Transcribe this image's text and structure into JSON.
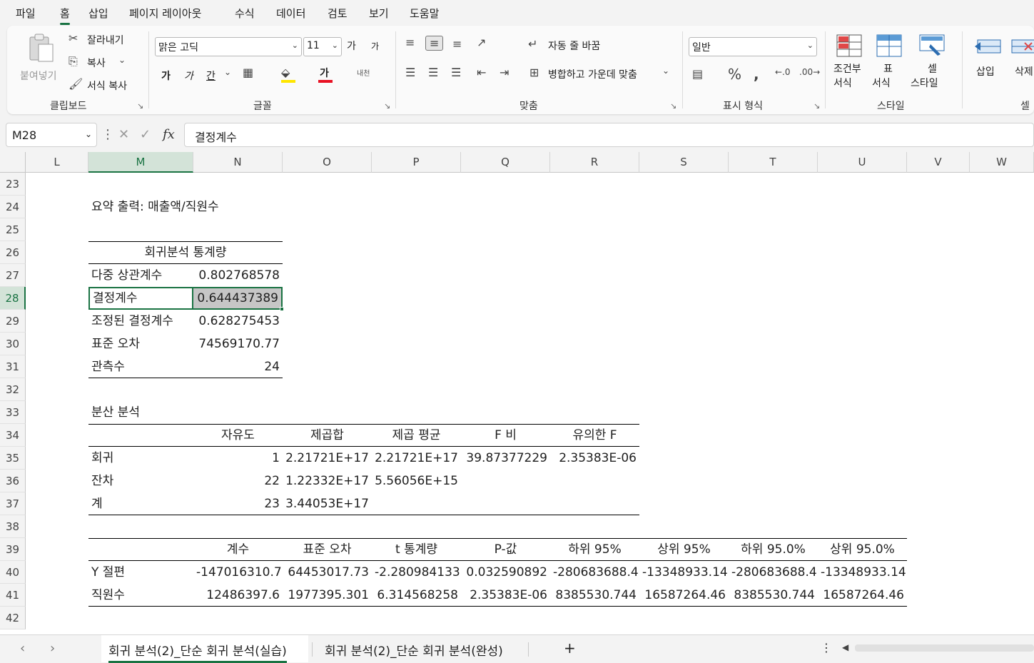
{
  "menu": [
    "파일",
    "홈",
    "삽입",
    "페이지 레이아웃",
    "수식",
    "데이터",
    "검토",
    "보기",
    "도움말"
  ],
  "ribbon": {
    "clipboard": {
      "paste": "붙여넣기",
      "cut": "잘라내기",
      "copy": "복사",
      "format_painter": "서식 복사",
      "label": "클립보드"
    },
    "font": {
      "name": "맑은 고딕",
      "size": "11",
      "grow": "가",
      "shrink": "가",
      "bold": "가",
      "italic": "가",
      "underline": "간",
      "color_letter": "가",
      "phonetic": "내천",
      "label": "글꼴"
    },
    "align": {
      "wrap": "자동 줄 바꿈",
      "merge": "병합하고 가운데 맞춤",
      "label": "맞춤"
    },
    "number": {
      "format": "일반",
      "label": "표시 형식"
    },
    "styles": {
      "conditional": [
        "조건부",
        "서식"
      ],
      "table": [
        "표",
        "서식"
      ],
      "cell": [
        "셀",
        "스타일"
      ],
      "label": "스타일"
    },
    "cells": {
      "insert": "삽입",
      "delete": "삭제",
      "label": "셀"
    }
  },
  "formula_bar": {
    "name_box": "M28",
    "content": "결정계수"
  },
  "columns": [
    "L",
    "M",
    "N",
    "O",
    "P",
    "Q",
    "R",
    "S",
    "T",
    "U",
    "V",
    "W"
  ],
  "rows": [
    "23",
    "24",
    "25",
    "26",
    "27",
    "28",
    "29",
    "30",
    "31",
    "32",
    "33",
    "34",
    "35",
    "36",
    "37",
    "38",
    "39",
    "40",
    "41",
    "42"
  ],
  "sheet": {
    "summary_title": "요약 출력: 매출액/직원수",
    "regression_stats_header": "회귀분석 통계량",
    "regression_stats": [
      {
        "label": "다중 상관계수",
        "value": "0.802768578"
      },
      {
        "label": "결정계수",
        "value": "0.644437389"
      },
      {
        "label": "조정된 결정계수",
        "value": "0.628275453"
      },
      {
        "label": "표준 오차",
        "value": "74569170.77"
      },
      {
        "label": "관측수",
        "value": "24"
      }
    ],
    "anova_title": "분산 분석",
    "anova_headers": [
      "자유도",
      "제곱합",
      "제곱 평균",
      "F 비",
      "유의한 F"
    ],
    "anova_rows": [
      {
        "label": "회귀",
        "cells": [
          "1",
          "2.21721E+17",
          "2.21721E+17",
          "39.87377229",
          "2.35383E-06"
        ]
      },
      {
        "label": "잔차",
        "cells": [
          "22",
          "1.22332E+17",
          "5.56056E+15",
          "",
          ""
        ]
      },
      {
        "label": "계",
        "cells": [
          "23",
          "3.44053E+17",
          "",
          "",
          ""
        ]
      }
    ],
    "coef_headers": [
      "계수",
      "표준 오차",
      "t 통계량",
      "P-값",
      "하위 95%",
      "상위 95%",
      "하위 95.0%",
      "상위 95.0%"
    ],
    "coef_rows": [
      {
        "label": "Y 절편",
        "cells": [
          "-147016310.7",
          "64453017.73",
          "-2.280984133",
          "0.032590892",
          "-280683688.4",
          "-13348933.14",
          "-280683688.4",
          "-13348933.14"
        ]
      },
      {
        "label": "직원수",
        "cells": [
          "12486397.6",
          "1977395.301",
          "6.314568258",
          "2.35383E-06",
          "8385530.744",
          "16587264.46",
          "8385530.744",
          "16587264.46"
        ]
      }
    ]
  },
  "tabs": [
    "회귀 분석(2)_단순 회귀 분석(실습)",
    "회귀 분석(2)_단순 회귀 분석(완성)"
  ],
  "add_sheet": "+",
  "colors": {
    "accent": "#1a7343",
    "selected_fill": "#c6c6c6"
  }
}
